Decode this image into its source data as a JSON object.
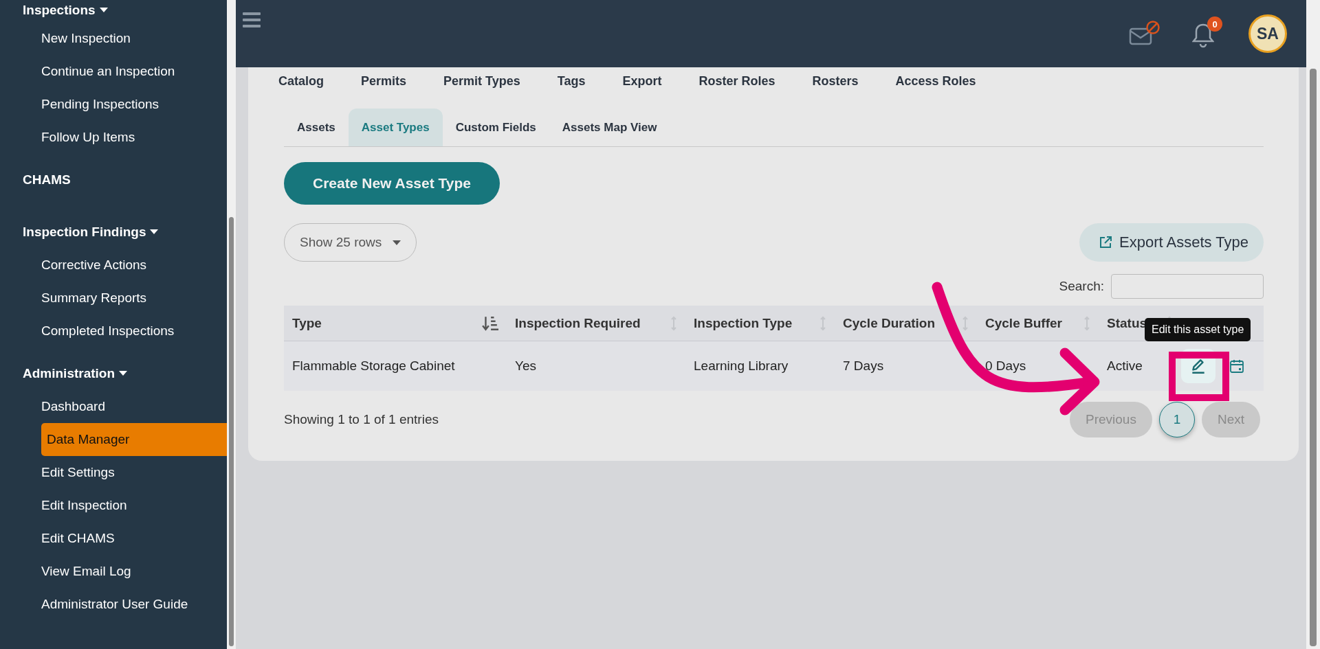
{
  "sidebar": {
    "sections": [
      {
        "kind": "group",
        "label": "Inspections",
        "expanded": true,
        "items": [
          {
            "label": "New Inspection",
            "selected": false
          },
          {
            "label": "Continue an Inspection",
            "selected": false
          },
          {
            "label": "Pending Inspections",
            "selected": false
          },
          {
            "label": "Follow Up Items",
            "selected": false
          }
        ]
      },
      {
        "kind": "link",
        "label": "CHAMS"
      },
      {
        "kind": "group",
        "label": "Inspection Findings",
        "expanded": true,
        "items": [
          {
            "label": "Corrective Actions",
            "selected": false
          },
          {
            "label": "Summary Reports",
            "selected": false
          },
          {
            "label": "Completed Inspections",
            "selected": false
          }
        ]
      },
      {
        "kind": "group",
        "label": "Administration",
        "expanded": true,
        "items": [
          {
            "label": "Dashboard",
            "selected": false
          },
          {
            "label": "Data Manager",
            "selected": true
          },
          {
            "label": "Edit Settings",
            "selected": false
          },
          {
            "label": "Edit Inspection",
            "selected": false
          },
          {
            "label": "Edit CHAMS",
            "selected": false
          },
          {
            "label": "View Email Log",
            "selected": false
          },
          {
            "label": "Administrator User Guide",
            "selected": false
          }
        ]
      }
    ]
  },
  "header": {
    "notification_count": "0",
    "avatar_initials": "SA"
  },
  "top_tabs": [
    {
      "label": "Catalog",
      "selected": false
    },
    {
      "label": "Permits",
      "selected": false
    },
    {
      "label": "Permit Types",
      "selected": false
    },
    {
      "label": "Tags",
      "selected": false
    },
    {
      "label": "Export",
      "selected": false
    },
    {
      "label": "Roster Roles",
      "selected": false
    },
    {
      "label": "Rosters",
      "selected": false
    },
    {
      "label": "Access Roles",
      "selected": false
    }
  ],
  "sub_tabs": [
    {
      "label": "Assets",
      "selected": false
    },
    {
      "label": "Asset Types",
      "selected": true
    },
    {
      "label": "Custom Fields",
      "selected": false
    },
    {
      "label": "Assets Map View",
      "selected": false
    }
  ],
  "create_button": "Create New Asset Type",
  "rows_select": "Show 25 rows",
  "export_button": "Export Assets Type",
  "search": {
    "label": "Search:"
  },
  "table": {
    "columns": [
      {
        "label": "Type",
        "sorted": true
      },
      {
        "label": "Inspection Required",
        "sorted": false
      },
      {
        "label": "Inspection Type",
        "sorted": false
      },
      {
        "label": "Cycle Duration",
        "sorted": false
      },
      {
        "label": "Cycle Buffer",
        "sorted": false
      },
      {
        "label": "Status",
        "sorted": false
      }
    ],
    "rows": [
      {
        "cells": [
          "Flammable Storage Cabinet",
          "Yes",
          "Learning Library",
          "7 Days",
          "0 Days",
          "Active"
        ]
      }
    ]
  },
  "tooltip": "Edit this asset type",
  "info": "Showing 1 to 1 of 1 entries",
  "pagination": {
    "previous": {
      "label": "Previous",
      "disabled": true
    },
    "pages": [
      {
        "label": "1",
        "selected": true
      }
    ],
    "next": {
      "label": "Next",
      "disabled": true
    }
  }
}
